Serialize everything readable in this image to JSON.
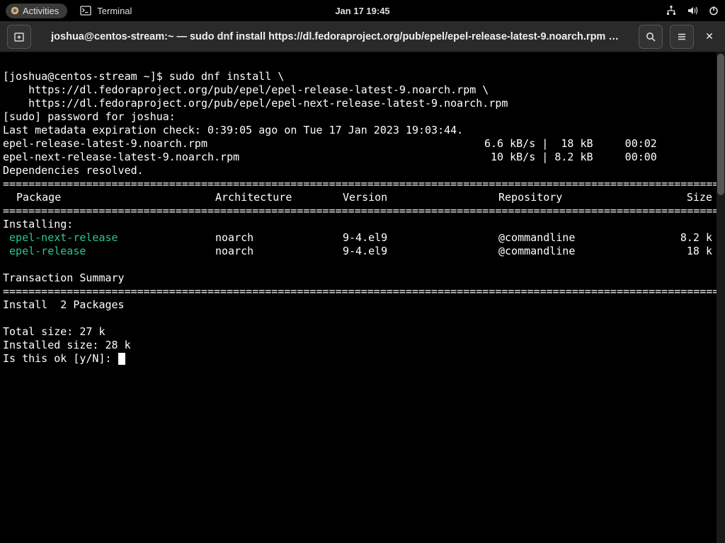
{
  "topbar": {
    "activities": "Activities",
    "app": "Terminal",
    "datetime": "Jan 17  19:45"
  },
  "titlebar": {
    "title": "joshua@centos-stream:~ — sudo dnf install https://dl.fedoraproject.org/pub/epel/epel-release-latest-9.noarch.rpm …"
  },
  "term": {
    "prompt": "[joshua@centos-stream ~]$ ",
    "cmd1": "sudo dnf install \\",
    "cmd2": "    https://dl.fedoraproject.org/pub/epel/epel-release-latest-9.noarch.rpm \\",
    "cmd3": "    https://dl.fedoraproject.org/pub/epel/epel-next-release-latest-9.noarch.rpm",
    "sudo": "[sudo] password for joshua: ",
    "meta": "Last metadata expiration check: 0:39:05 ago on Tue 17 Jan 2023 19:03:44.",
    "dl1_name": "epel-release-latest-9.noarch.rpm",
    "dl1_stat": "6.6 kB/s |  18 kB     00:02    ",
    "dl2_name": "epel-next-release-latest-9.noarch.rpm",
    "dl2_stat": " 10 kB/s | 8.2 kB     00:00    ",
    "deps": "Dependencies resolved.",
    "header": {
      "pkg": " Package",
      "arch": "Architecture",
      "ver": "Version",
      "repo": "Repository",
      "size": "Size"
    },
    "installing": "Installing:",
    "pkgs": [
      {
        "name": " epel-next-release",
        "arch": "noarch",
        "ver": "9-4.el9",
        "repo": "@commandline",
        "size": "8.2 k"
      },
      {
        "name": " epel-release",
        "arch": "noarch",
        "ver": "9-4.el9",
        "repo": "@commandline",
        "size": "18 k"
      }
    ],
    "tsummary": "Transaction Summary",
    "install_count": "Install  2 Packages",
    "total_size": "Total size: 27 k",
    "installed_size": "Installed size: 28 k",
    "confirm": "Is this ok [y/N]: "
  }
}
